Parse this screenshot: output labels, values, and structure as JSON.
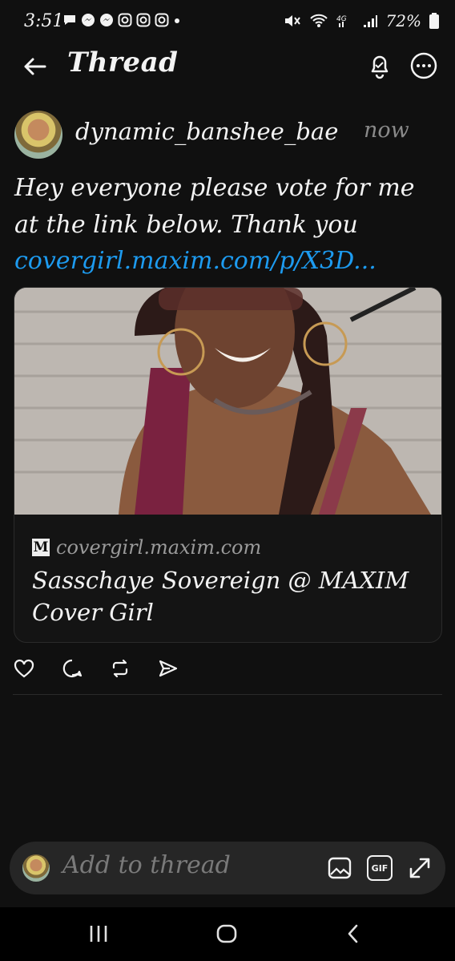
{
  "status_bar": {
    "time": "3:51",
    "battery": "72%",
    "notification_icons": [
      "chat-bubble-icon",
      "messenger-icon",
      "messenger-icon",
      "instagram-icon",
      "instagram-icon",
      "instagram-icon",
      "dot-icon"
    ]
  },
  "header": {
    "title": "Thread"
  },
  "post": {
    "username": "dynamic_banshee_bae",
    "time": "now",
    "text": "Hey everyone please vote for me at the link below. Thank you",
    "link": "covergirl.maxim.com/p/X3D...",
    "link_card": {
      "domain": "covergirl.maxim.com",
      "logo_letter": "M",
      "title": "Sasschaye Sovereign @ MAXIM Cover Girl"
    }
  },
  "composer": {
    "placeholder": "Add to thread",
    "gif_label": "GIF"
  },
  "colors": {
    "background": "#101010",
    "link": "#1d9bf0",
    "muted": "#8a8a8a"
  }
}
